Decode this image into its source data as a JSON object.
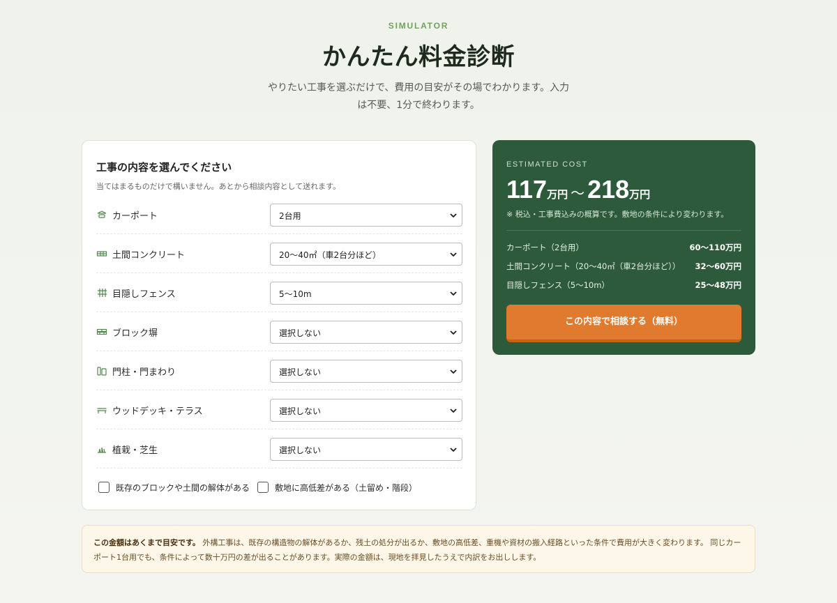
{
  "header": {
    "eyebrow": "SIMULATOR",
    "title": "かんたん料金診断",
    "lead": "やりたい工事を選ぶだけで、費用の目安がその場でわかります。入力は不要、1分で終わります。"
  },
  "form": {
    "heading": "工事の内容を選んでください",
    "subtext": "当てはまるものだけで構いません。あとから相談内容として送れます。",
    "rows": [
      {
        "label": "カーポート",
        "value": "2台用",
        "icon": "carport-icon"
      },
      {
        "label": "土間コンクリート",
        "value": "20〜40㎡（車2台分ほど）",
        "icon": "slab-icon"
      },
      {
        "label": "目隠しフェンス",
        "value": "5〜10m",
        "icon": "fence-icon"
      },
      {
        "label": "ブロック塀",
        "value": "選択しない",
        "icon": "block-wall-icon"
      },
      {
        "label": "門柱・門まわり",
        "value": "選択しない",
        "icon": "gate-icon"
      },
      {
        "label": "ウッドデッキ・テラス",
        "value": "選択しない",
        "icon": "deck-icon"
      },
      {
        "label": "植栽・芝生",
        "value": "選択しない",
        "icon": "plant-icon"
      }
    ],
    "checkboxes": [
      {
        "label": "既存のブロックや土間の解体がある",
        "checked": false
      },
      {
        "label": "敷地に高低差がある（土留め・階段）",
        "checked": false
      }
    ]
  },
  "estimate": {
    "label": "ESTIMATED COST",
    "min": "117",
    "max": "218",
    "unit": "万円",
    "tilde": "〜",
    "note": "※ 税込・工事費込みの概算です。敷地の条件により変わります。",
    "breakdown": [
      {
        "name": "カーポート（2台用）",
        "value": "60〜110万円"
      },
      {
        "name": "土間コンクリート（20〜40㎡（車2台分ほど））",
        "value": "32〜60万円"
      },
      {
        "name": "目隠しフェンス（5〜10m）",
        "value": "25〜48万円"
      }
    ],
    "cta": "この内容で相談する（無料）"
  },
  "notice": {
    "bold": "この金額はあくまで目安です。",
    "text": "外構工事は、既存の構造物の解体があるか、残土の処分が出るか、敷地の高低差、重機や資材の搬入経路といった条件で費用が大きく変わります。 同じカーポート1台用でも、条件によって数十万円の差が出ることがあります。実際の金額は、現地を拝見したうえで内訳をお出しします。"
  },
  "colors": {
    "accent_green": "#2d5a3b",
    "cta_orange": "#e07a2e",
    "eyebrow_green": "#6ea35b"
  }
}
